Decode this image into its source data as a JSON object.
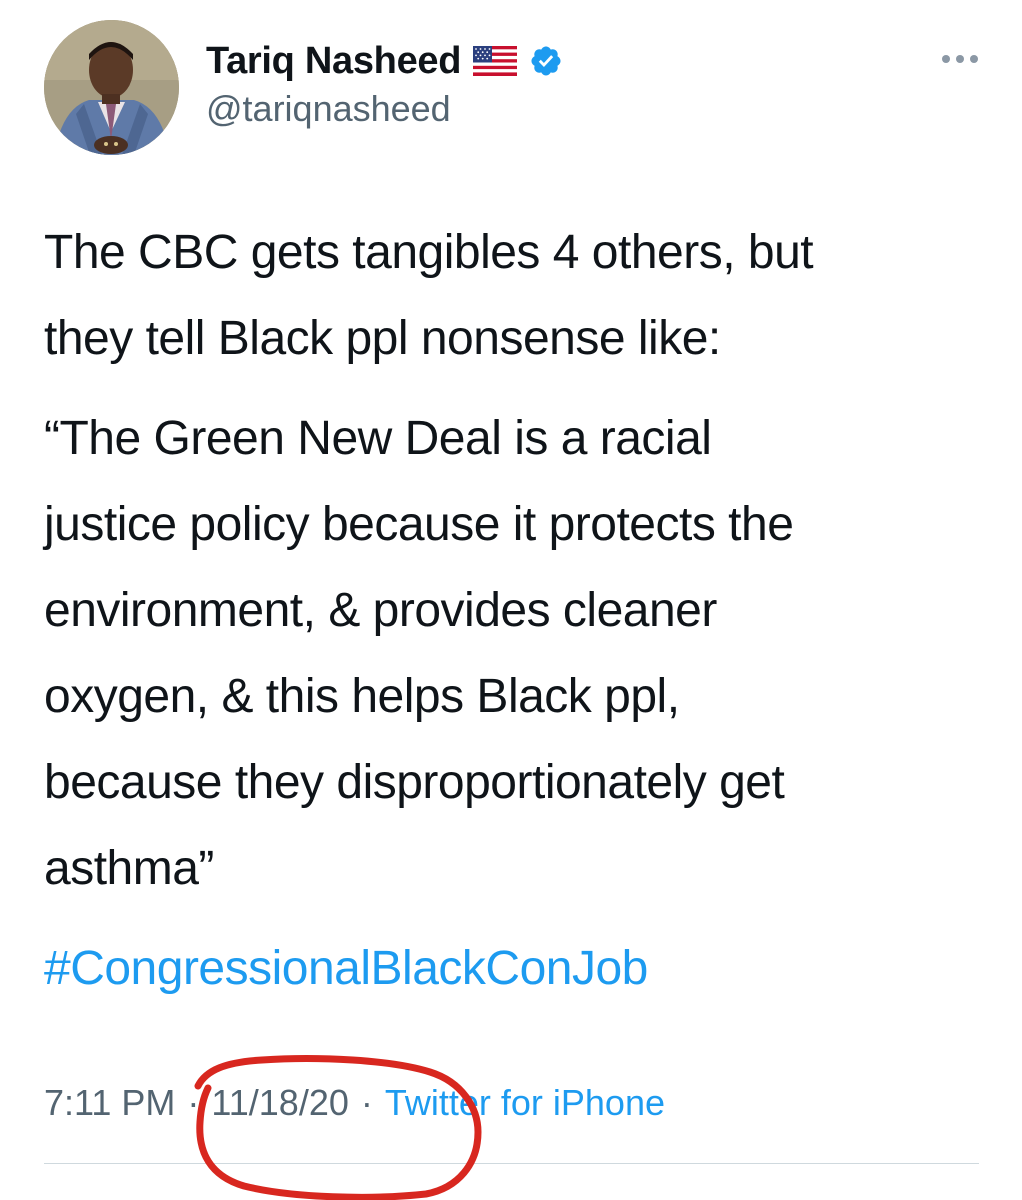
{
  "user": {
    "name": "Tariq Nasheed",
    "handle": "@tariqnasheed",
    "badge": "verified-badge-icon",
    "flag": "us-flag-icon"
  },
  "tweet": {
    "lines_1": [
      "The CBC gets tangibles 4 others, but",
      "they tell Black ppl nonsense like:"
    ],
    "lines_2": [
      "“The Green New Deal is a racial",
      "justice policy because it protects the",
      "environment, & provides cleaner",
      "oxygen, & this helps Black ppl,",
      "because they disproportionately get",
      "asthma”"
    ],
    "hashtag": "#CongressionalBlackConJob"
  },
  "meta": {
    "time": "7:11 PM",
    "date": "11/18/20",
    "source": "Twitter for iPhone",
    "separator": "·"
  },
  "colors": {
    "link": "#1d9bf0",
    "muted": "#536471",
    "annotation": "#d8271f"
  }
}
